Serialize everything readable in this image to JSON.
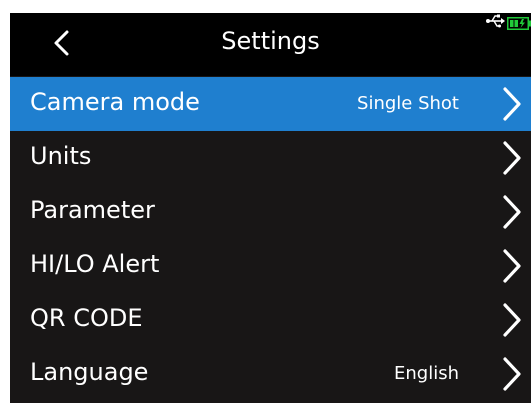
{
  "header": {
    "title": "Settings",
    "back_icon": "chevron-left-icon",
    "usb_icon": "usb-icon",
    "battery_icon": "battery-charging-icon"
  },
  "colors": {
    "background": "#181616",
    "header": "#000000",
    "selected": "#1f7fcf",
    "text": "#ffffff",
    "battery": "#21c93a"
  },
  "menu": {
    "items": [
      {
        "label": "Camera mode",
        "value": "Single Shot",
        "selected": true
      },
      {
        "label": "Units",
        "value": ""
      },
      {
        "label": "Parameter",
        "value": ""
      },
      {
        "label": "HI/LO Alert",
        "value": ""
      },
      {
        "label": "QR CODE",
        "value": ""
      },
      {
        "label": "Language",
        "value": "English"
      }
    ]
  }
}
